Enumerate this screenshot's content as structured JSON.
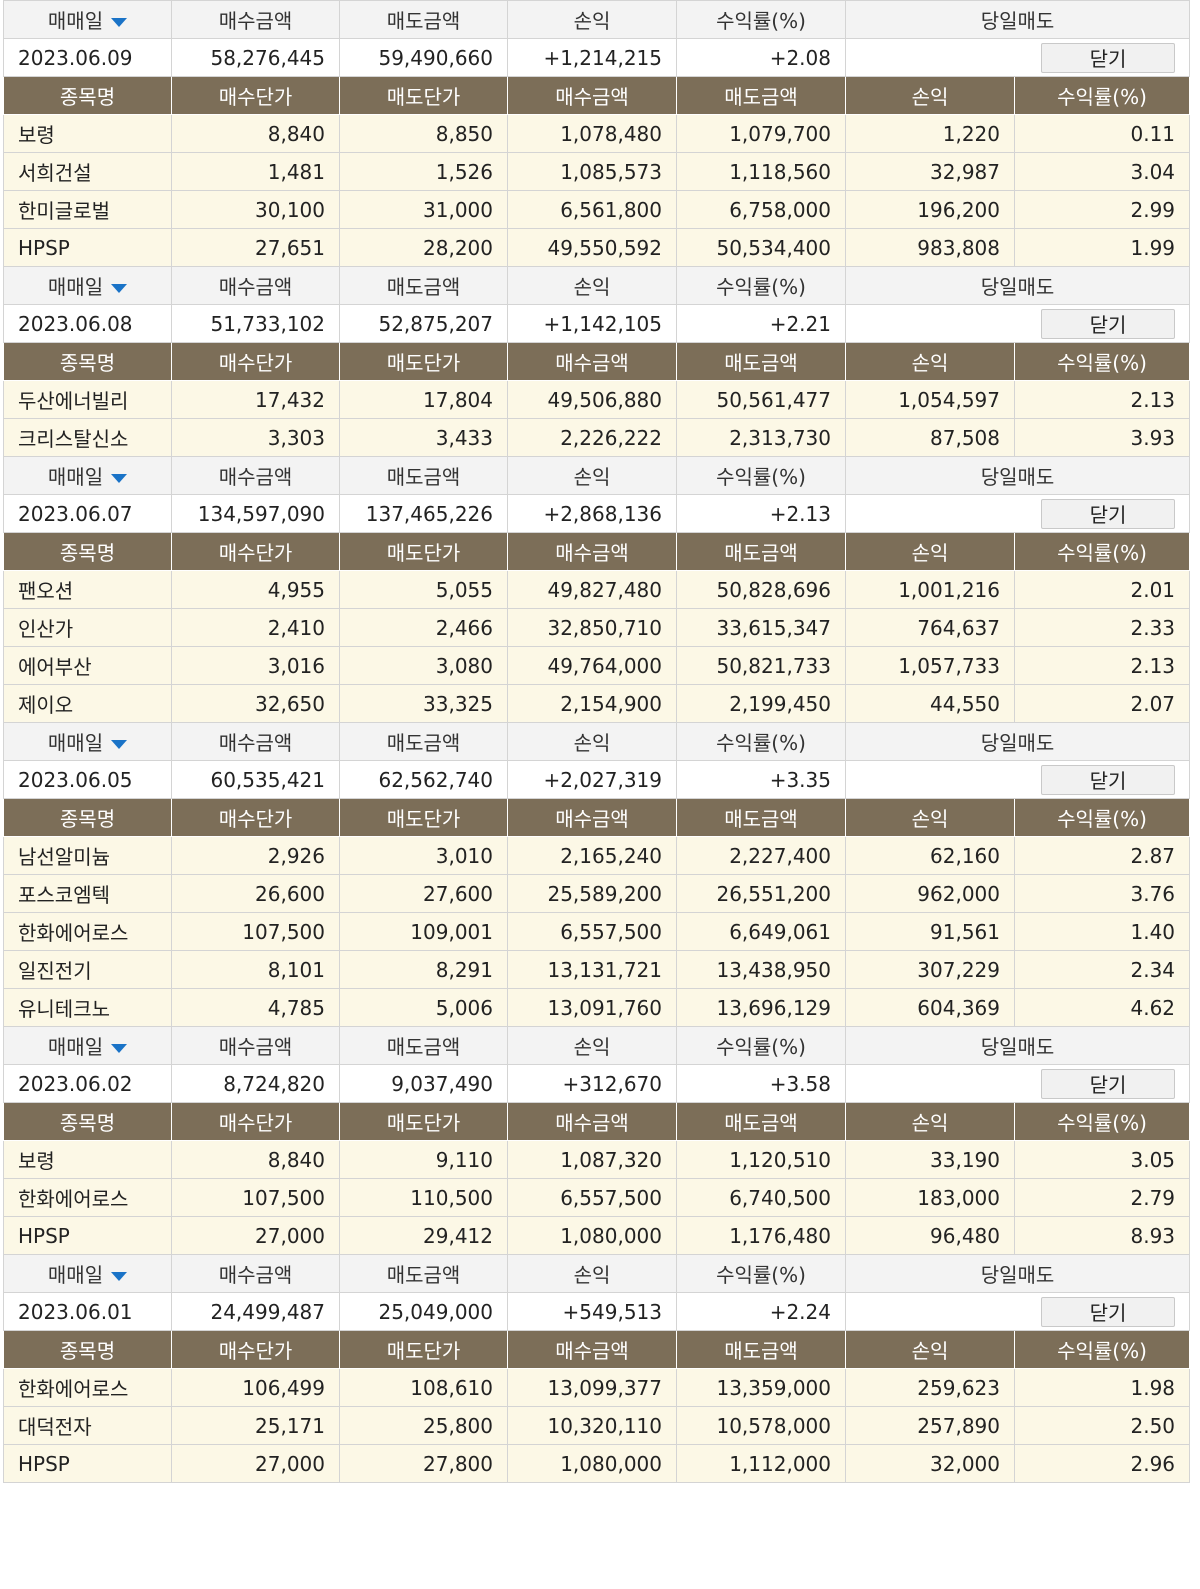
{
  "labels": {
    "trade_date": "매매일",
    "buy_amount": "매수금액",
    "sell_amount": "매도금액",
    "profit": "손익",
    "return_rate": "수익률(%)",
    "same_day_sell": "당일매도",
    "close_button": "닫기",
    "stock_name": "종목명",
    "buy_price": "매수단가",
    "sell_price": "매도단가"
  },
  "colors": {
    "header_brown": "#7c6e58",
    "row_cream": "#fcf8e6",
    "profit_red": "#e8354a",
    "arrow_blue": "#1a73c7"
  },
  "days": [
    {
      "date": "2023.06.09",
      "buy_amount": "58,276,445",
      "sell_amount": "59,490,660",
      "profit": "+1,214,215",
      "return_rate": "+2.08",
      "stocks": [
        {
          "name": "보령",
          "buy_price": "8,840",
          "sell_price": "8,850",
          "buy_amount": "1,078,480",
          "sell_amount": "1,079,700",
          "profit": "1,220",
          "return_rate": "0.11"
        },
        {
          "name": "서희건설",
          "buy_price": "1,481",
          "sell_price": "1,526",
          "buy_amount": "1,085,573",
          "sell_amount": "1,118,560",
          "profit": "32,987",
          "return_rate": "3.04"
        },
        {
          "name": "한미글로벌",
          "buy_price": "30,100",
          "sell_price": "31,000",
          "buy_amount": "6,561,800",
          "sell_amount": "6,758,000",
          "profit": "196,200",
          "return_rate": "2.99"
        },
        {
          "name": "HPSP",
          "buy_price": "27,651",
          "sell_price": "28,200",
          "buy_amount": "49,550,592",
          "sell_amount": "50,534,400",
          "profit": "983,808",
          "return_rate": "1.99"
        }
      ]
    },
    {
      "date": "2023.06.08",
      "buy_amount": "51,733,102",
      "sell_amount": "52,875,207",
      "profit": "+1,142,105",
      "return_rate": "+2.21",
      "stocks": [
        {
          "name": "두산에너빌리",
          "buy_price": "17,432",
          "sell_price": "17,804",
          "buy_amount": "49,506,880",
          "sell_amount": "50,561,477",
          "profit": "1,054,597",
          "return_rate": "2.13"
        },
        {
          "name": "크리스탈신소",
          "buy_price": "3,303",
          "sell_price": "3,433",
          "buy_amount": "2,226,222",
          "sell_amount": "2,313,730",
          "profit": "87,508",
          "return_rate": "3.93"
        }
      ]
    },
    {
      "date": "2023.06.07",
      "buy_amount": "134,597,090",
      "sell_amount": "137,465,226",
      "profit": "+2,868,136",
      "return_rate": "+2.13",
      "stocks": [
        {
          "name": "팬오션",
          "buy_price": "4,955",
          "sell_price": "5,055",
          "buy_amount": "49,827,480",
          "sell_amount": "50,828,696",
          "profit": "1,001,216",
          "return_rate": "2.01"
        },
        {
          "name": "인산가",
          "buy_price": "2,410",
          "sell_price": "2,466",
          "buy_amount": "32,850,710",
          "sell_amount": "33,615,347",
          "profit": "764,637",
          "return_rate": "2.33"
        },
        {
          "name": "에어부산",
          "buy_price": "3,016",
          "sell_price": "3,080",
          "buy_amount": "49,764,000",
          "sell_amount": "50,821,733",
          "profit": "1,057,733",
          "return_rate": "2.13"
        },
        {
          "name": "제이오",
          "buy_price": "32,650",
          "sell_price": "33,325",
          "buy_amount": "2,154,900",
          "sell_amount": "2,199,450",
          "profit": "44,550",
          "return_rate": "2.07"
        }
      ]
    },
    {
      "date": "2023.06.05",
      "buy_amount": "60,535,421",
      "sell_amount": "62,562,740",
      "profit": "+2,027,319",
      "return_rate": "+3.35",
      "stocks": [
        {
          "name": "남선알미늄",
          "buy_price": "2,926",
          "sell_price": "3,010",
          "buy_amount": "2,165,240",
          "sell_amount": "2,227,400",
          "profit": "62,160",
          "return_rate": "2.87"
        },
        {
          "name": "포스코엠텍",
          "buy_price": "26,600",
          "sell_price": "27,600",
          "buy_amount": "25,589,200",
          "sell_amount": "26,551,200",
          "profit": "962,000",
          "return_rate": "3.76"
        },
        {
          "name": "한화에어로스",
          "buy_price": "107,500",
          "sell_price": "109,001",
          "buy_amount": "6,557,500",
          "sell_amount": "6,649,061",
          "profit": "91,561",
          "return_rate": "1.40"
        },
        {
          "name": "일진전기",
          "buy_price": "8,101",
          "sell_price": "8,291",
          "buy_amount": "13,131,721",
          "sell_amount": "13,438,950",
          "profit": "307,229",
          "return_rate": "2.34"
        },
        {
          "name": "유니테크노",
          "buy_price": "4,785",
          "sell_price": "5,006",
          "buy_amount": "13,091,760",
          "sell_amount": "13,696,129",
          "profit": "604,369",
          "return_rate": "4.62"
        }
      ]
    },
    {
      "date": "2023.06.02",
      "buy_amount": "8,724,820",
      "sell_amount": "9,037,490",
      "profit": "+312,670",
      "return_rate": "+3.58",
      "stocks": [
        {
          "name": "보령",
          "buy_price": "8,840",
          "sell_price": "9,110",
          "buy_amount": "1,087,320",
          "sell_amount": "1,120,510",
          "profit": "33,190",
          "return_rate": "3.05"
        },
        {
          "name": "한화에어로스",
          "buy_price": "107,500",
          "sell_price": "110,500",
          "buy_amount": "6,557,500",
          "sell_amount": "6,740,500",
          "profit": "183,000",
          "return_rate": "2.79"
        },
        {
          "name": "HPSP",
          "buy_price": "27,000",
          "sell_price": "29,412",
          "buy_amount": "1,080,000",
          "sell_amount": "1,176,480",
          "profit": "96,480",
          "return_rate": "8.93"
        }
      ]
    },
    {
      "date": "2023.06.01",
      "buy_amount": "24,499,487",
      "sell_amount": "25,049,000",
      "profit": "+549,513",
      "return_rate": "+2.24",
      "stocks": [
        {
          "name": "한화에어로스",
          "buy_price": "106,499",
          "sell_price": "108,610",
          "buy_amount": "13,099,377",
          "sell_amount": "13,359,000",
          "profit": "259,623",
          "return_rate": "1.98"
        },
        {
          "name": "대덕전자",
          "buy_price": "25,171",
          "sell_price": "25,800",
          "buy_amount": "10,320,110",
          "sell_amount": "10,578,000",
          "profit": "257,890",
          "return_rate": "2.50"
        },
        {
          "name": "HPSP",
          "buy_price": "27,000",
          "sell_price": "27,800",
          "buy_amount": "1,080,000",
          "sell_amount": "1,112,000",
          "profit": "32,000",
          "return_rate": "2.96"
        }
      ]
    }
  ]
}
